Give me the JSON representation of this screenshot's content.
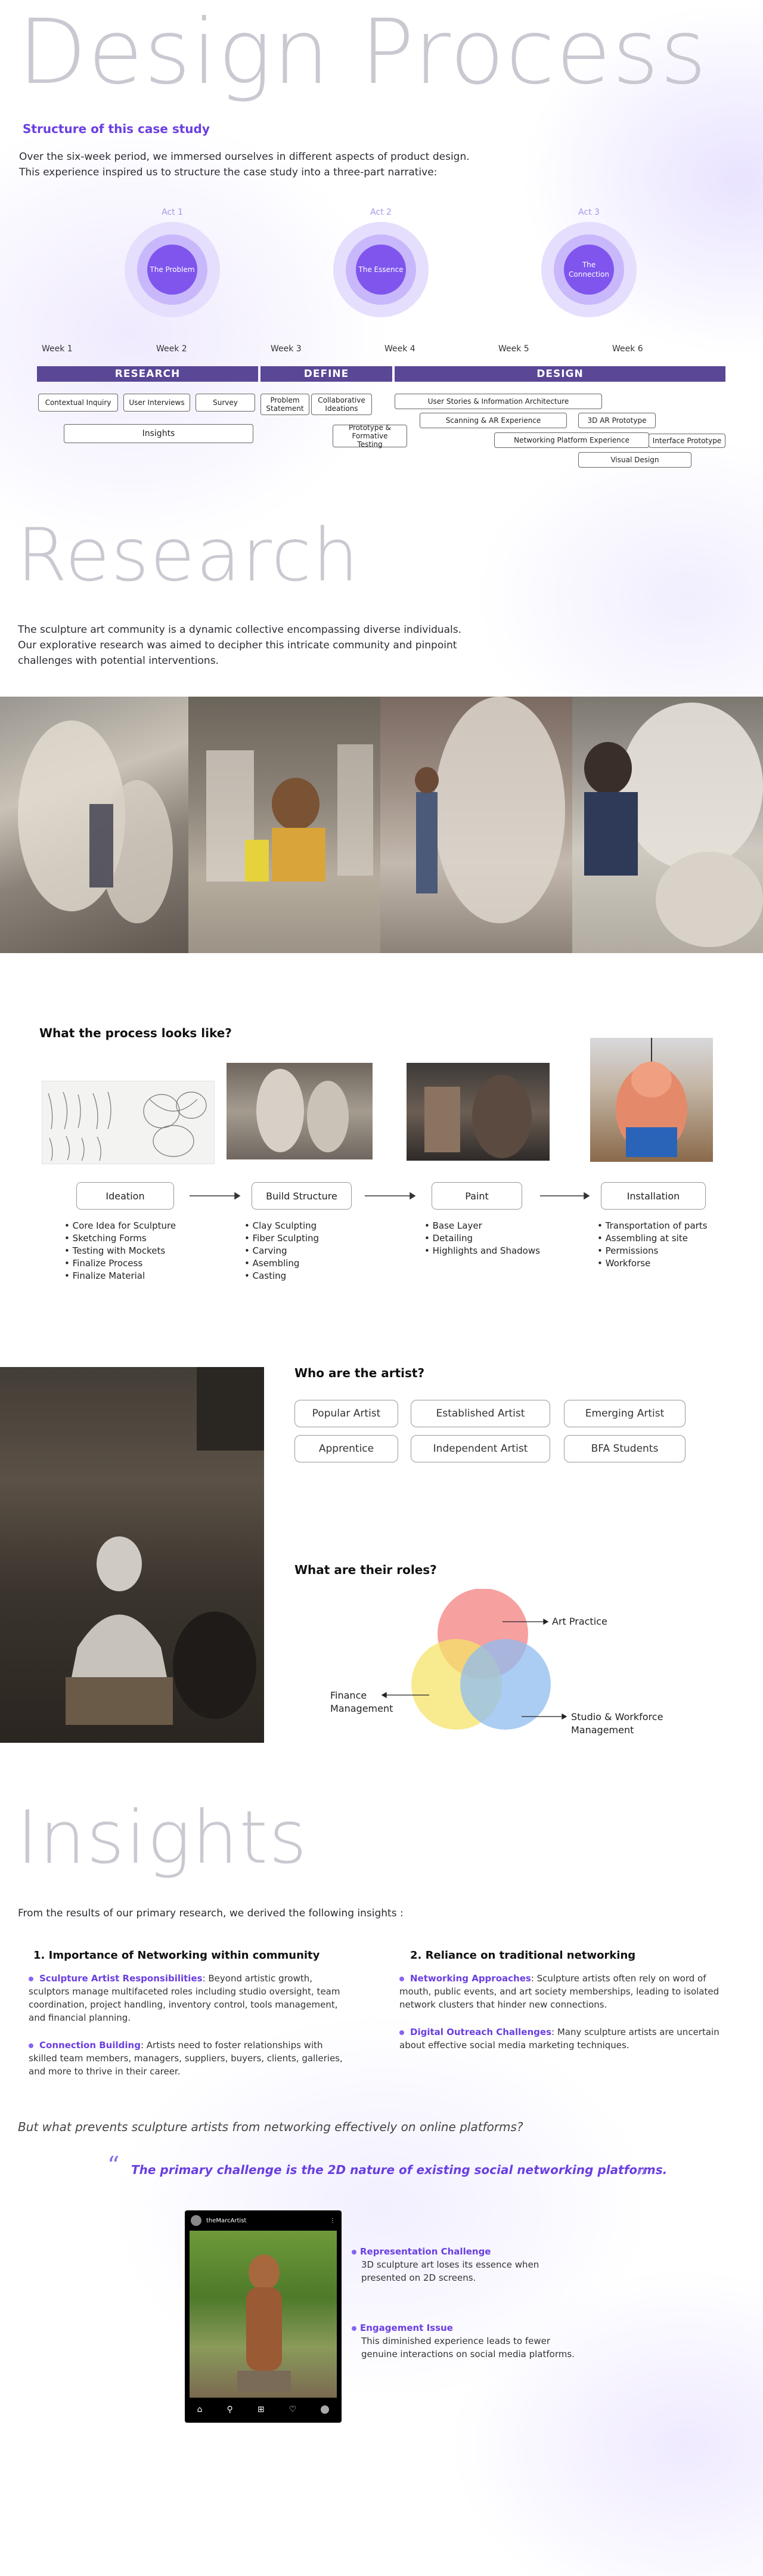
{
  "hero": {
    "title": "Design Process"
  },
  "structure": {
    "heading": "Structure of this case study",
    "line1": "Over the six-week period, we immersed ourselves in different aspects of product design.",
    "line2": "This experience inspired us to structure the case study into a three-part narrative:"
  },
  "acts": [
    {
      "label": "Act 1",
      "title": "The Problem"
    },
    {
      "label": "Act 2",
      "title": "The Essence"
    },
    {
      "label": "Act 3",
      "title": "The Connection"
    }
  ],
  "weeks": [
    "Week 1",
    "Week 2",
    "Week 3",
    "Week 4",
    "Week 5",
    "Week 6"
  ],
  "phases": [
    "RESEARCH",
    "DEFINE",
    "DESIGN"
  ],
  "tasks": {
    "contextual_inquiry": "Contextual Inquiry",
    "user_interviews": "User Interviews",
    "survey": "Survey",
    "insights": "Insights",
    "problem_statement": "Problem Statement",
    "collaborative_ideations": "Collaborative Ideations",
    "prototype_formative": "Prototype & Formative Testing",
    "user_stories": "User Stories & Information Architecture",
    "scanning_ar": "Scanning & AR Experience",
    "ar_prototype": "3D AR Prototype",
    "networking_platform": "Networking Platform Experience",
    "interface_prototype": "Interface Prototype",
    "visual_design": "Visual Design"
  },
  "research": {
    "title": "Research",
    "line1": "The sculpture art community is a dynamic collective encompassing diverse individuals.",
    "line2": "Our explorative research was aimed to decipher this intricate community and pinpoint",
    "line3": "challenges with potential interventions."
  },
  "process": {
    "heading": "What the process looks like?",
    "stages": [
      {
        "name": "Ideation",
        "items": [
          "Core Idea for Sculpture",
          "Sketching Forms",
          "Testing with Mockets",
          "Finalize Process",
          "Finalize Material"
        ]
      },
      {
        "name": "Build Structure",
        "items": [
          "Clay Sculpting",
          "Fiber Sculpting",
          "Carving",
          "Asembling",
          "Casting"
        ]
      },
      {
        "name": "Paint",
        "items": [
          "Base Layer",
          "Detailing",
          "Highlights and Shadows"
        ]
      },
      {
        "name": "Installation",
        "items": [
          "Transportation of parts",
          "Assembling at site",
          "Permissions",
          "Workforse"
        ]
      }
    ]
  },
  "artists": {
    "heading": "Who are the artist?",
    "types": [
      "Popular Artist",
      "Established Artist",
      "Emerging Artist",
      "Apprentice",
      "Independent Artist",
      "BFA Students"
    ]
  },
  "roles": {
    "heading": "What are their roles?",
    "art_practice": "Art Practice",
    "finance": "Finance Management",
    "studio": "Studio & Workforce Management",
    "colors": {
      "art": "#f48080",
      "finance": "#f6e36a",
      "studio": "#8fbcf0"
    }
  },
  "insights": {
    "title": "Insights",
    "intro": "From the results of our primary research, we derived the following insights :",
    "col1": {
      "heading": "1. Importance of Networking within community",
      "p1_bold": "Sculpture Artist Responsibilities",
      "p1": ": Beyond artistic growth, sculptors manage multifaceted roles including studio oversight, team coordination, project handling, inventory control, tools management, and financial planning.",
      "p2_bold": "Connection Building",
      "p2": ": Artists need to foster relationships with skilled team members, managers, suppliers, buyers, clients, galleries, and more to thrive in their career."
    },
    "col2": {
      "heading": "2. Reliance on traditional networking",
      "p1_bold": "Networking Approaches",
      "p1": ": Sculpture artists often rely on word of mouth, public events, and art society memberships, leading to isolated network clusters that hinder new connections.",
      "p2_bold": "Digital Outreach Challenges",
      "p2": ": Many sculpture artists are uncertain about effective social media marketing techniques."
    },
    "question": "But what prevents sculpture artists from networking effectively on online platforms?",
    "quote": "The primary challenge is the 2D nature of existing social networking platforms.",
    "phone_user": "theMarcArtist",
    "c1_title": "Representation Challenge",
    "c1_text": "3D sculpture art loses its essence when presented on 2D screens.",
    "c2_title": "Engagement Issue",
    "c2_text": "This diminished experience leads to fewer genuine interactions on social media platforms."
  },
  "accent": "#6a3fe0"
}
